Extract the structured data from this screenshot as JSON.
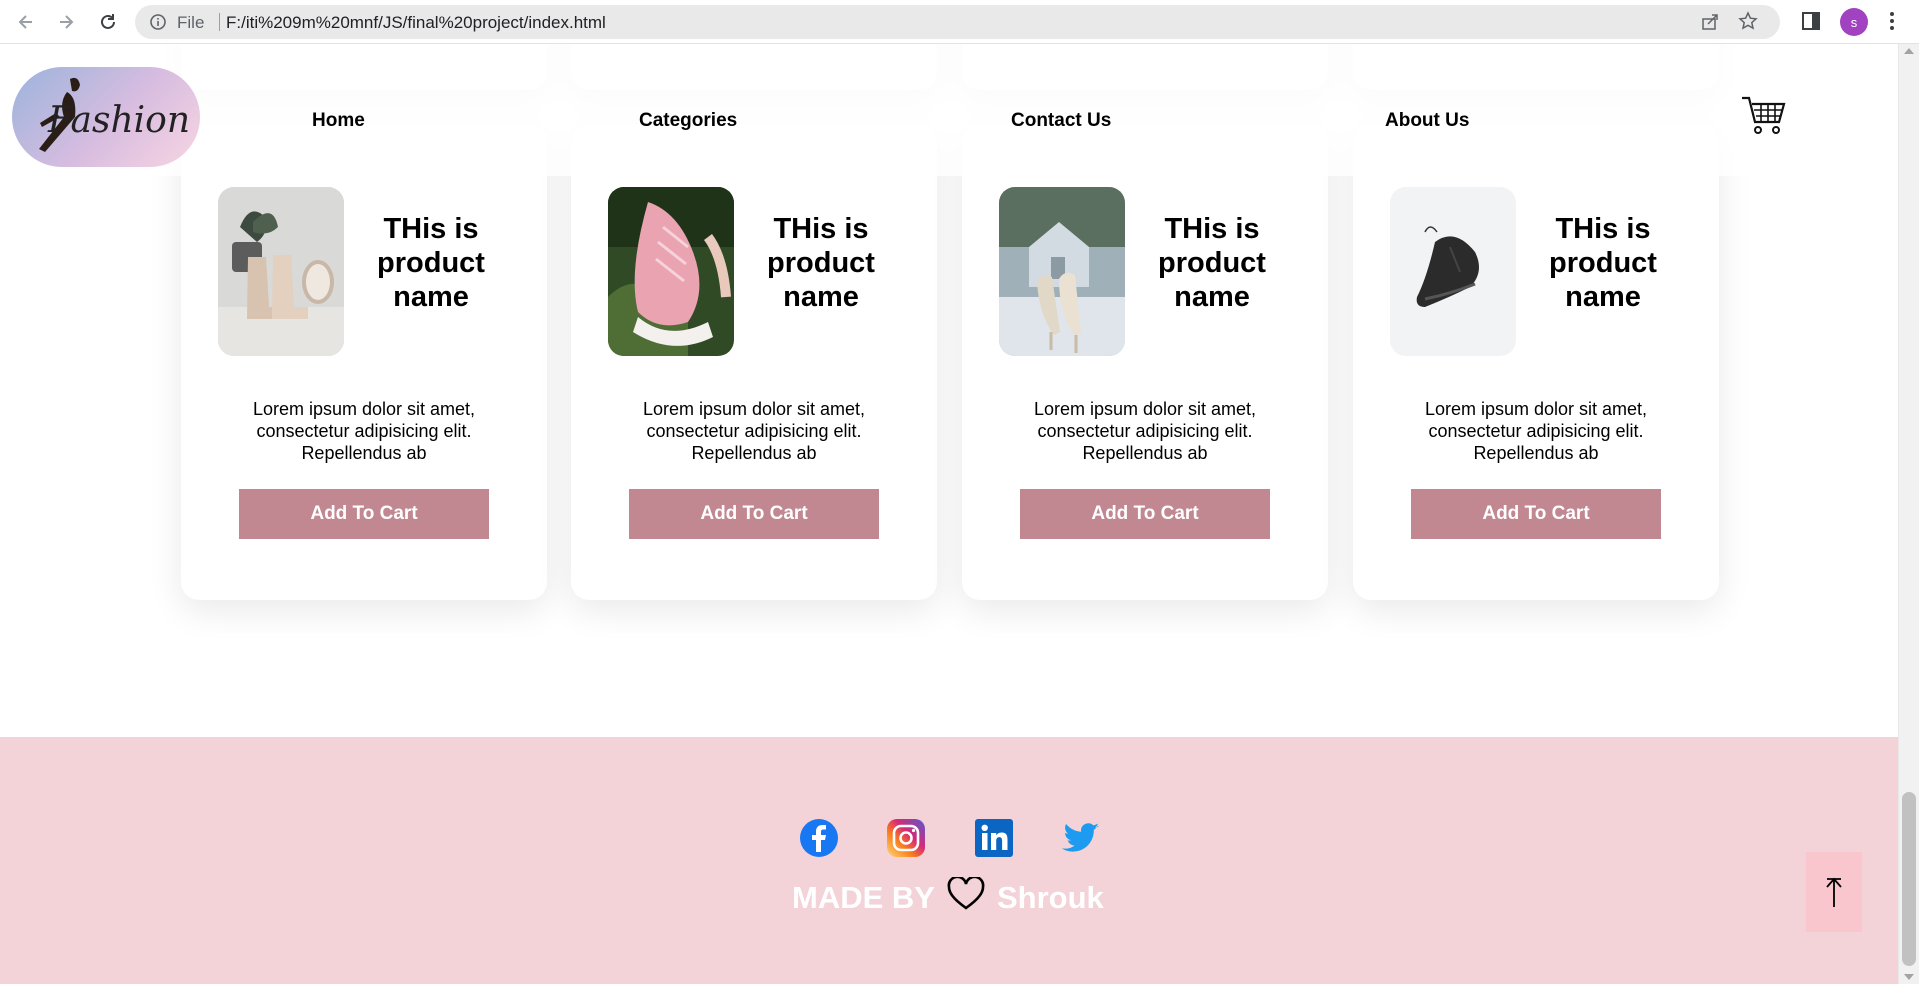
{
  "browser": {
    "file_label": "File",
    "url": "F:/iti%209m%20mnf/JS/final%20project/index.html",
    "profile_initial": "s"
  },
  "header": {
    "logo_text": "Fashion",
    "nav": [
      "Home",
      "Categories",
      "Contact Us",
      "About Us"
    ]
  },
  "products": [
    {
      "name": "THis is product name",
      "description": "Lorem ipsum dolor sit amet, consectetur adipisicing elit. Repellendus ab",
      "button": "Add To Cart",
      "image": "beige-boots"
    },
    {
      "name": "THis is product name",
      "description": "Lorem ipsum dolor sit amet, consectetur adipisicing elit. Repellendus ab",
      "button": "Add To Cart",
      "image": "pink-sneakers"
    },
    {
      "name": "THis is product name",
      "description": "Lorem ipsum dolor sit amet, consectetur adipisicing elit. Repellendus ab",
      "button": "Add To Cart",
      "image": "glitter-heels"
    },
    {
      "name": "THis is product name",
      "description": "Lorem ipsum dolor sit amet, consectetur adipisicing elit. Repellendus ab",
      "button": "Add To Cart",
      "image": "black-sneaker"
    }
  ],
  "footer": {
    "made_by": "MADE BY",
    "author": "Shrouk",
    "social": [
      "facebook-icon",
      "instagram-icon",
      "linkedin-icon",
      "twitter-icon"
    ]
  },
  "colors": {
    "button": "#c18891",
    "footer_bg": "#f3d2d8",
    "to_top_bg": "#f9c6ce"
  }
}
